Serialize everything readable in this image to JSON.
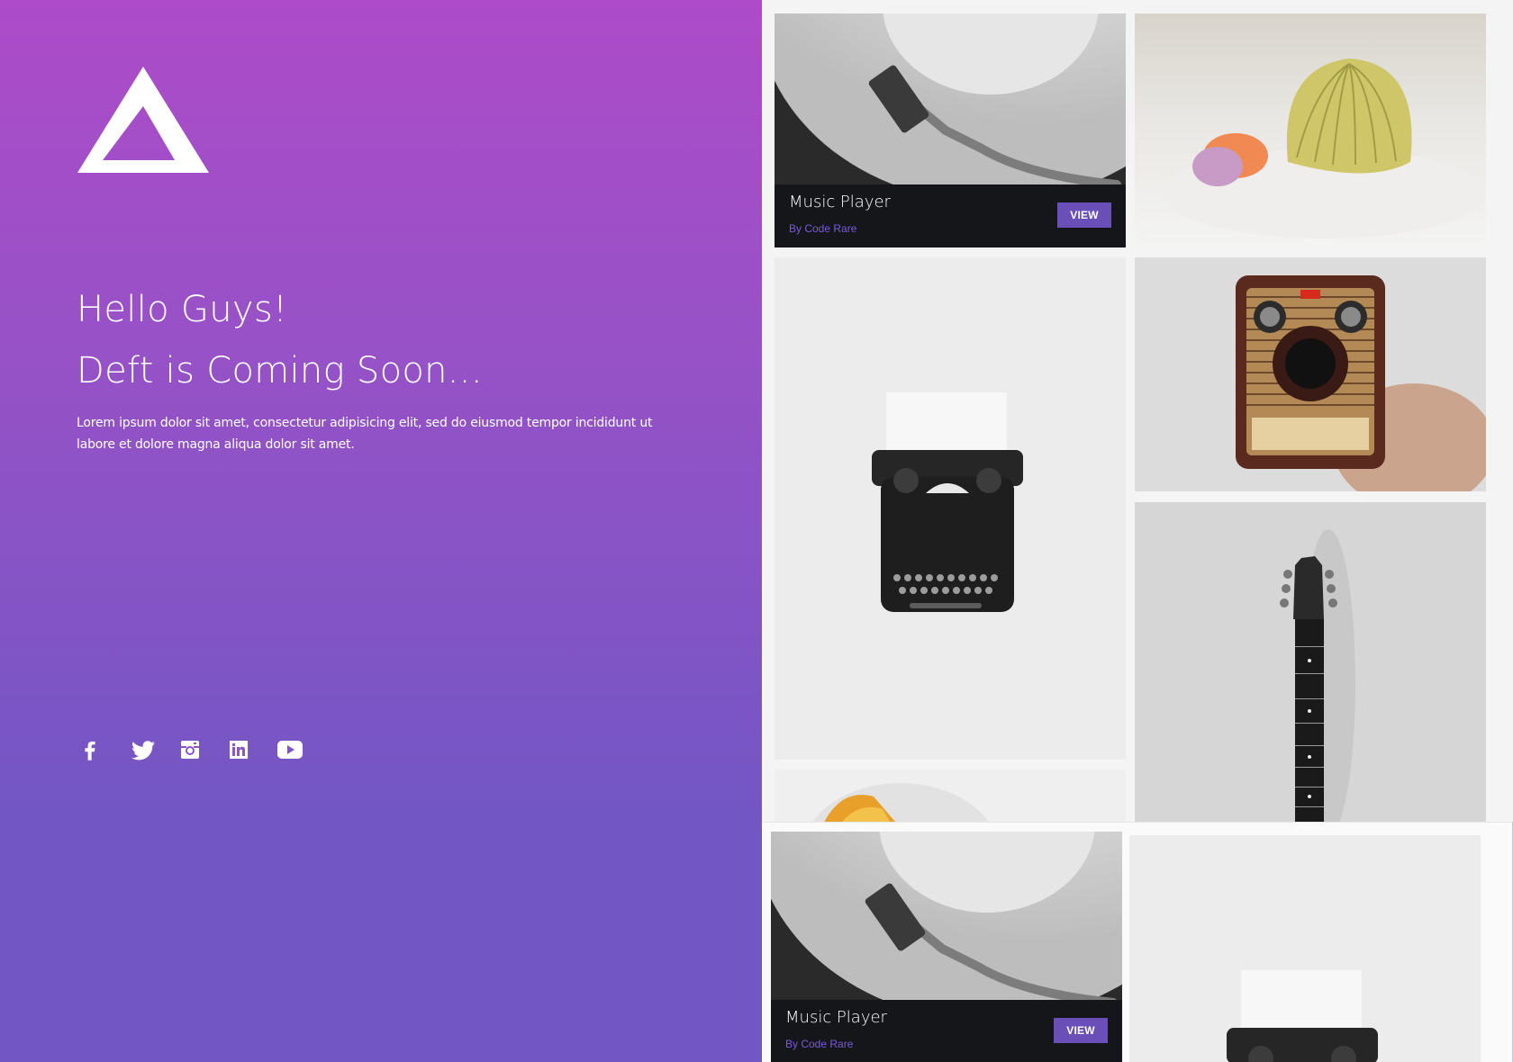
{
  "hero": {
    "title_line1": "Hello Guys!",
    "title_line2": "Deft is Coming Soon...",
    "text": "Lorem ipsum dolor sit amet, consectetur adipisicing elit, sed do eiusmod tempor incididunt ut labore et dolore magna aliqua dolor sit amet.",
    "logo_icon": "triangle-logo-icon",
    "gradient_top": "#ad4bc9",
    "gradient_bottom": "#7156c4"
  },
  "social": [
    {
      "icon": "facebook-icon",
      "glyph": "f"
    },
    {
      "icon": "twitter-icon",
      "glyph": "twitter"
    },
    {
      "icon": "instagram-icon",
      "glyph": "instagram"
    },
    {
      "icon": "linkedin-icon",
      "glyph": "in"
    },
    {
      "icon": "youtube-icon",
      "glyph": "play"
    }
  ],
  "gallery": {
    "tiles": [
      {
        "subject": "turntable",
        "caption": {
          "title": "Music Player",
          "by": "By Code Rare",
          "button": "VIEW"
        }
      },
      {
        "subject": "seashells"
      },
      {
        "subject": "typewriter"
      },
      {
        "subject": "camera"
      },
      {
        "subject": "guitar"
      },
      {
        "subject": "bowl"
      }
    ],
    "overlay_tiles": [
      {
        "subject": "turntable",
        "caption": {
          "title": "Music Player",
          "by": "By Code Rare",
          "button": "VIEW"
        }
      },
      {
        "subject": "typewriter"
      }
    ],
    "accent_color": "#6b4fb8"
  }
}
